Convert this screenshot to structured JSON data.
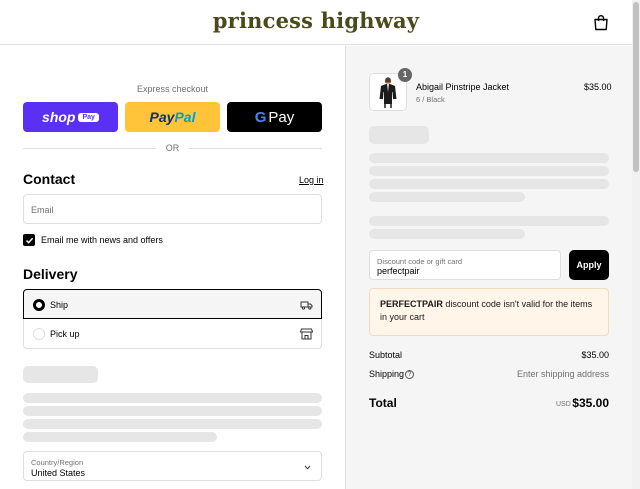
{
  "header": {
    "logo_text": "princess highway",
    "cart_icon": "shopping-bag-icon"
  },
  "express": {
    "label": "Express checkout",
    "shop_pay": {
      "shop": "shop",
      "pay": "Pay"
    },
    "paypal": {
      "pay": "Pay",
      "pal": "Pal"
    },
    "gpay": {
      "g": "G",
      "pay": "Pay"
    },
    "or_label": "OR"
  },
  "contact": {
    "title": "Contact",
    "login_link": "Log in",
    "email_placeholder": "Email",
    "news_label": "Email me with news and offers",
    "news_checked": true
  },
  "delivery": {
    "title": "Delivery",
    "options": [
      {
        "label": "Ship",
        "selected": true,
        "icon": "truck-icon"
      },
      {
        "label": "Pick up",
        "selected": false,
        "icon": "store-icon"
      }
    ],
    "country_label": "Country/Region",
    "country_value": "United States"
  },
  "summary": {
    "item": {
      "quantity": "1",
      "name": "Abigail Pinstripe Jacket",
      "variant": "6 / Black",
      "price": "$35.00"
    },
    "discount": {
      "label": "Discount code or gift card",
      "value": "perfectpair",
      "apply_label": "Apply"
    },
    "error": {
      "code": "PERFECTPAIR",
      "message": " discount code isn't valid for the items in your cart"
    },
    "subtotal_label": "Subtotal",
    "subtotal_value": "$35.00",
    "shipping_label": "Shipping",
    "shipping_value": "Enter shipping address",
    "total_label": "Total",
    "currency": "USD",
    "total_value": "$35.00"
  },
  "colors": {
    "shop_pay": "#5a31f4",
    "paypal": "#ffc439",
    "gpay": "#000000",
    "error_bg": "#fff5e9",
    "logo": "#4a4a1c"
  }
}
